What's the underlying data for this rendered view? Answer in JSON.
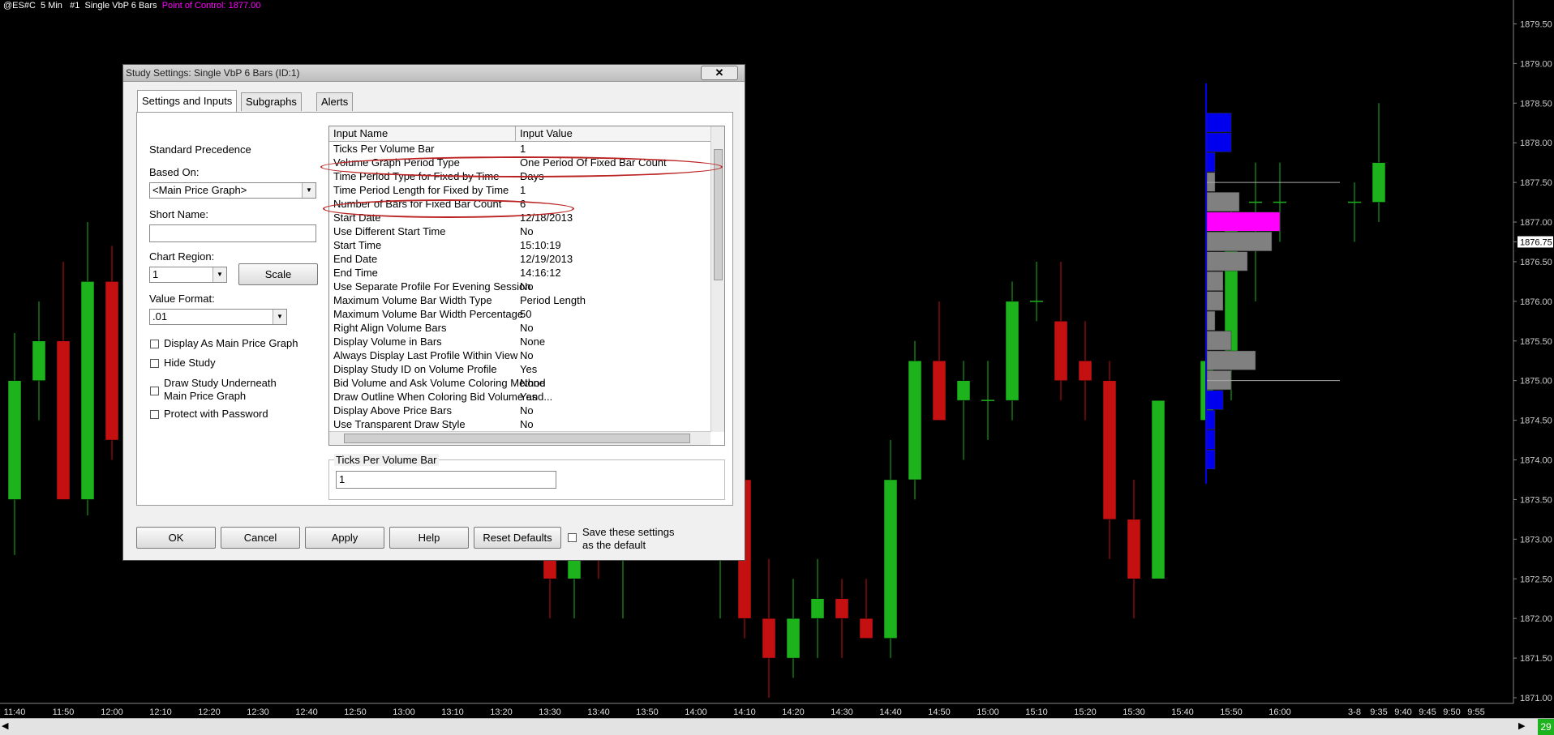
{
  "chart": {
    "symbol": "@ES#C",
    "interval": "5 Min",
    "study_index": "#1",
    "study_name": "Single VbP 6 Bars",
    "poc_text": "Point of Control: 1877.00",
    "price_labels": [
      "1879.50",
      "1879.00",
      "1878.50",
      "1878.00",
      "1877.50",
      "1877.00",
      "1876.75",
      "1876.50",
      "1876.00",
      "1875.50",
      "1875.00",
      "1874.50",
      "1874.00",
      "1873.50",
      "1873.00",
      "1872.50",
      "1872.00",
      "1871.50",
      "1871.00"
    ],
    "current_price": "1876.75",
    "time_labels": [
      "11:40",
      "11:50",
      "12:00",
      "12:10",
      "12:20",
      "12:30",
      "12:40",
      "12:50",
      "13:00",
      "13:10",
      "13:20",
      "13:30",
      "13:40",
      "13:50",
      "14:00",
      "14:10",
      "14:20",
      "14:30",
      "14:40",
      "14:50",
      "15:00",
      "15:10",
      "15:20",
      "15:30",
      "15:40",
      "15:50",
      "16:00",
      "3-8",
      "9:35",
      "9:40",
      "9:45",
      "9:50",
      "9:55"
    ],
    "status_count": "29",
    "colors": {
      "up": "#1cb31c",
      "down": "#c41010",
      "poc": "#ff00ff",
      "buy": "#0000ee",
      "neutral": "#808080"
    }
  },
  "chart_data": {
    "type": "candlestick",
    "price_range": [
      1871.0,
      1879.75
    ],
    "point_of_control": 1877.0,
    "candles": [
      {
        "time": "11:40",
        "open": 1873.5,
        "high": 1875.6,
        "low": 1872.8,
        "close": 1875.0
      },
      {
        "time": "11:45",
        "open": 1875.0,
        "high": 1876.0,
        "low": 1874.5,
        "close": 1875.5
      },
      {
        "time": "11:50",
        "open": 1875.5,
        "high": 1876.5,
        "low": 1873.5,
        "close": 1873.5
      },
      {
        "time": "11:55",
        "open": 1873.5,
        "high": 1877.0,
        "low": 1873.3,
        "close": 1876.25
      },
      {
        "time": "12:00",
        "open": 1876.25,
        "high": 1876.7,
        "low": 1874.0,
        "close": 1874.25
      },
      {
        "time": "13:30",
        "open": 1873.0,
        "high": 1873.0,
        "low": 1872.0,
        "close": 1872.5
      },
      {
        "time": "13:35",
        "open": 1872.5,
        "high": 1873.3,
        "low": 1872.0,
        "close": 1873.0
      },
      {
        "time": "13:40",
        "open": 1873.0,
        "high": 1873.3,
        "low": 1872.5,
        "close": 1872.75
      },
      {
        "time": "13:45",
        "open": 1872.75,
        "high": 1873.3,
        "low": 1872.0,
        "close": 1873.0
      },
      {
        "time": "14:05",
        "open": 1872.75,
        "high": 1873.5,
        "low": 1872.0,
        "close": 1873.0
      },
      {
        "time": "14:10",
        "open": 1873.75,
        "high": 1874.0,
        "low": 1871.75,
        "close": 1872.0
      },
      {
        "time": "14:15",
        "open": 1872.0,
        "high": 1872.75,
        "low": 1871.0,
        "close": 1871.5
      },
      {
        "time": "14:20",
        "open": 1871.5,
        "high": 1872.5,
        "low": 1871.25,
        "close": 1872.0
      },
      {
        "time": "14:25",
        "open": 1872.0,
        "high": 1872.75,
        "low": 1871.5,
        "close": 1872.25
      },
      {
        "time": "14:30",
        "open": 1872.25,
        "high": 1872.5,
        "low": 1871.5,
        "close": 1872.0
      },
      {
        "time": "14:35",
        "open": 1872.0,
        "high": 1872.5,
        "low": 1871.75,
        "close": 1871.75
      },
      {
        "time": "14:40",
        "open": 1871.75,
        "high": 1874.25,
        "low": 1871.5,
        "close": 1873.75
      },
      {
        "time": "14:45",
        "open": 1873.75,
        "high": 1875.5,
        "low": 1873.5,
        "close": 1875.25
      },
      {
        "time": "14:50",
        "open": 1875.25,
        "high": 1876.0,
        "low": 1874.5,
        "close": 1874.5
      },
      {
        "time": "14:55",
        "open": 1874.75,
        "high": 1875.25,
        "low": 1874.0,
        "close": 1875.0
      },
      {
        "time": "15:00",
        "open": 1874.75,
        "high": 1875.25,
        "low": 1874.25,
        "close": 1874.75
      },
      {
        "time": "15:05",
        "open": 1874.75,
        "high": 1876.25,
        "low": 1874.5,
        "close": 1876.0
      },
      {
        "time": "15:10",
        "open": 1876.0,
        "high": 1876.5,
        "low": 1875.75,
        "close": 1876.0
      },
      {
        "time": "15:15",
        "open": 1875.75,
        "high": 1876.5,
        "low": 1874.75,
        "close": 1875.0
      },
      {
        "time": "15:20",
        "open": 1875.25,
        "high": 1875.75,
        "low": 1874.5,
        "close": 1875.0
      },
      {
        "time": "15:25",
        "open": 1875.0,
        "high": 1875.25,
        "low": 1872.75,
        "close": 1873.25
      },
      {
        "time": "15:30",
        "open": 1873.25,
        "high": 1873.75,
        "low": 1872.0,
        "close": 1872.5
      },
      {
        "time": "15:35",
        "open": 1872.5,
        "high": 1874.75,
        "low": 1872.5,
        "close": 1874.75
      },
      {
        "time": "15:45",
        "open": 1874.5,
        "high": 1875.5,
        "low": 1874.5,
        "close": 1875.25
      },
      {
        "time": "15:50",
        "open": 1875.25,
        "high": 1877.25,
        "low": 1874.75,
        "close": 1877.0
      },
      {
        "time": "15:55",
        "open": 1877.25,
        "high": 1877.75,
        "low": 1876.0,
        "close": 1877.25
      },
      {
        "time": "16:00",
        "open": 1877.25,
        "high": 1877.75,
        "low": 1876.75,
        "close": 1877.25
      },
      {
        "time": "3-8",
        "open": 1877.25,
        "high": 1877.5,
        "low": 1876.75,
        "close": 1877.25
      },
      {
        "time": "9:35",
        "open": 1877.25,
        "high": 1878.5,
        "low": 1877.0,
        "close": 1877.75
      }
    ],
    "volume_profile": [
      {
        "price": 1878.25,
        "volume": 3,
        "color": "buy"
      },
      {
        "price": 1878.0,
        "volume": 3,
        "color": "buy"
      },
      {
        "price": 1877.75,
        "volume": 1,
        "color": "buy"
      },
      {
        "price": 1877.5,
        "volume": 1,
        "color": "neutral"
      },
      {
        "price": 1877.25,
        "volume": 4,
        "color": "neutral"
      },
      {
        "price": 1877.0,
        "volume": 9,
        "color": "poc"
      },
      {
        "price": 1876.75,
        "volume": 8,
        "color": "neutral"
      },
      {
        "price": 1876.5,
        "volume": 5,
        "color": "neutral"
      },
      {
        "price": 1876.25,
        "volume": 2,
        "color": "neutral"
      },
      {
        "price": 1876.0,
        "volume": 2,
        "color": "neutral"
      },
      {
        "price": 1875.75,
        "volume": 1,
        "color": "neutral"
      },
      {
        "price": 1875.5,
        "volume": 3,
        "color": "neutral"
      },
      {
        "price": 1875.25,
        "volume": 6,
        "color": "neutral"
      },
      {
        "price": 1875.0,
        "volume": 3,
        "color": "neutral"
      },
      {
        "price": 1874.75,
        "volume": 2,
        "color": "buy"
      },
      {
        "price": 1874.5,
        "volume": 1,
        "color": "buy"
      },
      {
        "price": 1874.25,
        "volume": 1,
        "color": "buy"
      },
      {
        "price": 1874.0,
        "volume": 1,
        "color": "buy"
      }
    ]
  },
  "dialog": {
    "title": "Study Settings: Single VbP 6 Bars (ID:1)",
    "close_label": "✕",
    "tabs": [
      "Settings and Inputs",
      "Subgraphs",
      "Alerts"
    ],
    "standard_precedence": "Standard Precedence",
    "based_on_label": "Based On:",
    "based_on_value": "<Main Price Graph>",
    "short_name_label": "Short Name:",
    "short_name_value": "",
    "chart_region_label": "Chart Region:",
    "chart_region_value": "1",
    "scale_button": "Scale",
    "value_format_label": "Value Format:",
    "value_format_value": ".01",
    "checkboxes": {
      "display_main": "Display As Main Price Graph",
      "hide_study": "Hide Study",
      "draw_underneath_1": "Draw Study Underneath",
      "draw_underneath_2": "Main Price Graph",
      "protect": "Protect with Password"
    },
    "grid": {
      "col_name": "Input Name",
      "col_value": "Input Value",
      "rows": [
        {
          "name": "Ticks Per Volume Bar",
          "value": "1"
        },
        {
          "name": "Volume Graph Period Type",
          "value": "One Period Of Fixed Bar Count"
        },
        {
          "name": "Time Period Type for Fixed by Time",
          "value": "Days"
        },
        {
          "name": "Time Period Length for Fixed by Time",
          "value": "1"
        },
        {
          "name": "Number of Bars for Fixed Bar Count",
          "value": "6"
        },
        {
          "name": "Start Date",
          "value": "12/18/2013"
        },
        {
          "name": "Use Different Start Time",
          "value": "No"
        },
        {
          "name": "Start Time",
          "value": "15:10:19"
        },
        {
          "name": "End Date",
          "value": "12/19/2013"
        },
        {
          "name": "End Time",
          "value": "14:16:12"
        },
        {
          "name": "Use Separate Profile For Evening Session",
          "value": "No"
        },
        {
          "name": "Maximum Volume Bar Width Type",
          "value": "Period Length"
        },
        {
          "name": "Maximum Volume Bar Width Percentage",
          "value": "50"
        },
        {
          "name": "Right Align Volume Bars",
          "value": "No"
        },
        {
          "name": "Display Volume in Bars",
          "value": "None"
        },
        {
          "name": "Always Display Last Profile Within View",
          "value": "No"
        },
        {
          "name": "Display Study ID on Volume Profile",
          "value": "Yes"
        },
        {
          "name": "Bid Volume and Ask Volume Coloring Method",
          "value": "None"
        },
        {
          "name": "Draw Outline When Coloring Bid Volume and...",
          "value": "Yes"
        },
        {
          "name": "Display Above Price Bars",
          "value": "No"
        },
        {
          "name": "Use Transparent Draw Style",
          "value": "No"
        }
      ]
    },
    "selected_input_label": "Ticks Per Volume Bar",
    "selected_input_value": "1",
    "buttons": {
      "ok": "OK",
      "cancel": "Cancel",
      "apply": "Apply",
      "help": "Help",
      "reset": "Reset Defaults"
    },
    "save_default_1": "Save these settings",
    "save_default_2": "as the default"
  }
}
